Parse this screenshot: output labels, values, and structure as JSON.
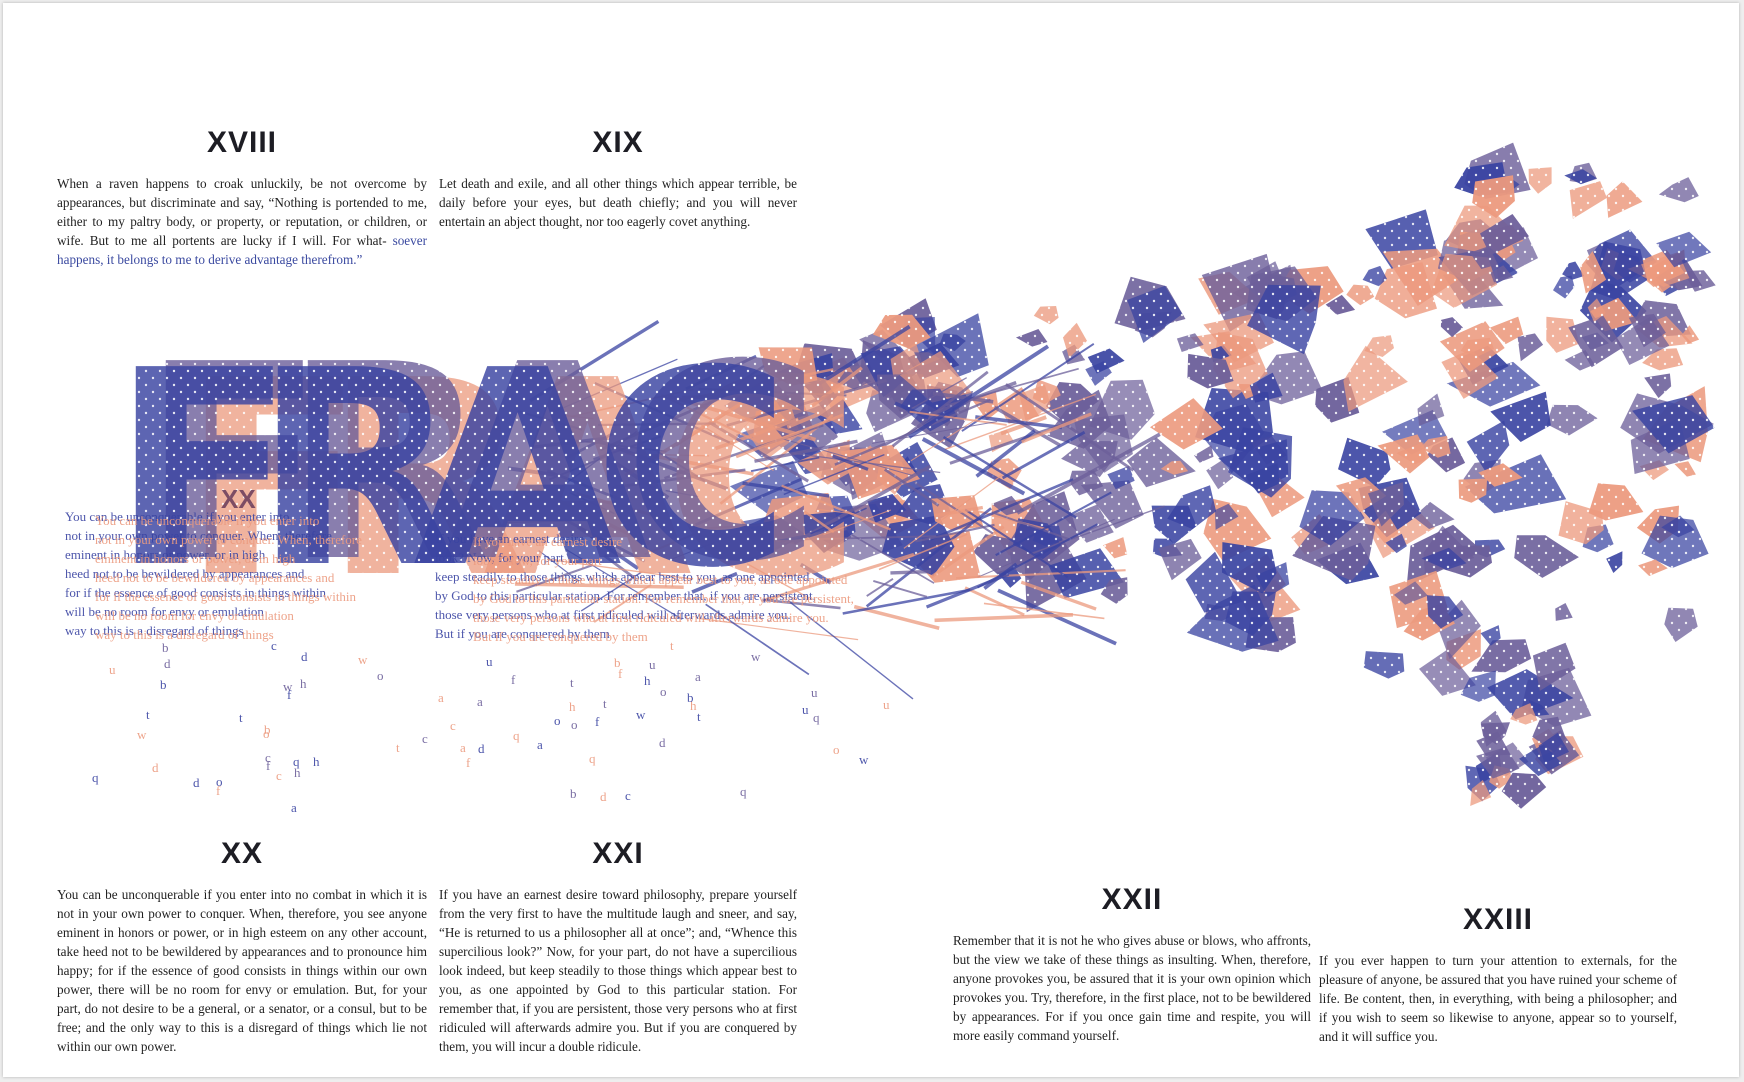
{
  "colors": {
    "blue": "#3a44a2",
    "purple": "#6c5f9a",
    "salmon": "#ec9a7e",
    "ink": "#1f1f1f"
  },
  "title": {
    "letters": [
      "F",
      "R",
      "A",
      "C",
      "T",
      "U",
      "R",
      "E"
    ]
  },
  "sections": {
    "xviii": {
      "numeral": "XVIII",
      "text": "When a raven happens to croak unluckily, be not overcome by appearances, but discriminate and say, “Nothing is portended to me, either to my paltry body, or property, or reputation, or children, or wife. But to me all portents are lucky if I will. For what-",
      "text_tail": "soever happens, it belongs to me to derive advantage therefrom.”"
    },
    "xix": {
      "numeral": "XIX",
      "text": "Let death and exile, and all other things which appear terrible, be daily before your eyes, but death chiefly; and you will never entertain an abject thought, nor too eagerly covet anything."
    },
    "xx": {
      "numeral": "XX",
      "text": "You can be unconquerable if you enter into no combat in which it is not in your own power to conquer. When, therefore, you see anyone eminent in honors or power, or in high esteem on any other account, take heed not to be bewildered by appearances and to pronounce him happy; for if the essence of good consists in things within our own power, there will be no room for envy or emulation. But, for your part, do not desire to be a general, or a senator, or a consul, but to be free; and the only way to this is a disregard of things which lie not within our own power."
    },
    "xxi": {
      "numeral": "XXI",
      "text": "If you have an earnest desire toward philosophy, prepare yourself from the very first to have the multitude laugh and sneer, and say, “He is returned to us a philosopher all at once”; and, “Whence this supercilious look?” Now, for your part, do not have a supercilious look indeed, but keep steadily to those things which appear best to you, as one appointed by God to this particular station. For remember that, if you are persistent, those very persons who at first ridiculed will afterwards admire you. But if you are conquered by them, you will incur a double ridicule."
    },
    "xxii": {
      "numeral": "XXII",
      "text": "Remember that it is not he who gives abuse or blows, who affronts, but the view we take of these things as insulting. When, therefore, anyone provokes you, be assured that it is your own opinion which provokes you. Try, therefore, in the first place, not to be bewildered by appearances. For if you once gain time and respite, you will more easily command yourself."
    },
    "xxiii": {
      "numeral": "XXIII",
      "text": "If you ever happen to turn your attention to externals, for the pleasure of anyone, be assured that you have ruined your scheme of life. Be content, then, in everything, with being a philosopher; and if you wish to seem so likewise to anyone, appear so to yourself, and it will suffice you."
    }
  },
  "fractured_echo": {
    "numeral": "XX",
    "lines": [
      "You can be unconquerable if you enter into",
      "not in your own power to conquer. When, therefore",
      "eminent in honors or power, or in high",
      "heed not to be bewildered by appearances and",
      "for if the essence of good consists in things within",
      "will be no room for envy or emulation",
      "way to this is a disregard of things"
    ],
    "lines_right": [
      "If you have an earnest desire",
      "look? Now, for your part",
      "keep steadily to those things which appear best to you, as one appointed",
      "by God to this particular station. For remember that, if you are persistent,",
      "those very persons who at first ridiculed will afterwards admire you.",
      "But if you are conquered by them"
    ],
    "scatter_letters": [
      "d",
      "o",
      "f",
      "t",
      "h",
      "a",
      "c",
      "w",
      "b",
      "q",
      "u"
    ]
  }
}
